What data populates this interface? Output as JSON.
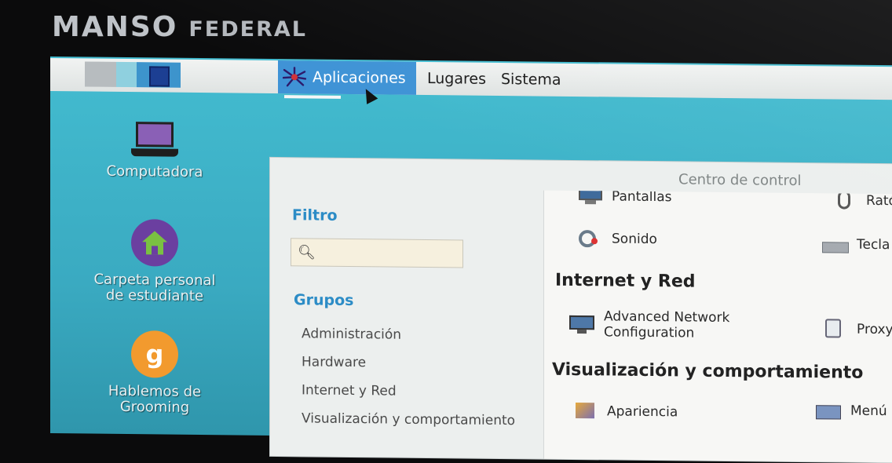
{
  "bezel": {
    "brand_main": "MANSO",
    "brand_sub": "FEDERAL"
  },
  "top_panel": {
    "menus": [
      {
        "label": "Aplicaciones"
      },
      {
        "label": "Lugares"
      },
      {
        "label": "Sistema"
      }
    ]
  },
  "desktop": {
    "icons": [
      {
        "label": "Computadora",
        "icon": "laptop-icon"
      },
      {
        "label": "Carpeta personal\nde estudiante",
        "icon": "home-folder-icon"
      },
      {
        "label": "Hablemos de\nGrooming",
        "icon": "grooming-icon",
        "glyph": "g"
      }
    ]
  },
  "control_center": {
    "title": "Centro de control",
    "filter_label": "Filtro",
    "search_placeholder": "",
    "groups_label": "Grupos",
    "groups": [
      "Administración",
      "Hardware",
      "Internet y Red",
      "Visualización y comportamiento"
    ],
    "items": {
      "pantallas": "Pantallas",
      "raton": "Ratón",
      "sonido": "Sonido",
      "teclado": "Tecla",
      "section_internet": "Internet y Red",
      "advanced_network_1": "Advanced Network",
      "advanced_network_2": "Configuration",
      "proxy": "Proxy",
      "section_visual": "Visualización y comportamiento",
      "apariencia": "Apariencia",
      "menu": "Menú P"
    }
  }
}
